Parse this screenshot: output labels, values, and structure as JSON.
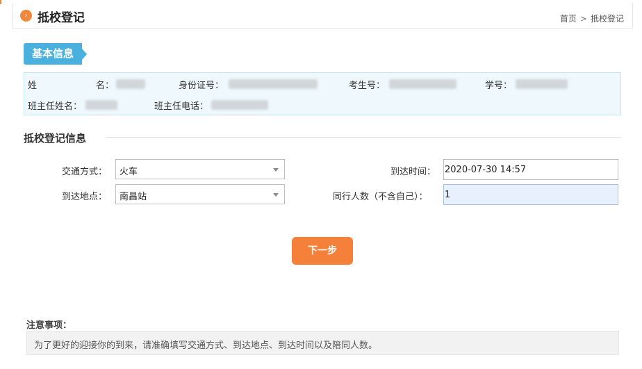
{
  "header": {
    "title": "抵校登记",
    "icon": "chevron-right-circle-icon",
    "breadcrumb": {
      "home": "首页",
      "separator": ">",
      "current": "抵校登记"
    }
  },
  "basic_info": {
    "tag": "基本信息",
    "name_label_1": "姓",
    "name_label_2": "名：",
    "id_label": "身份证号：",
    "exam_no_label": "考生号：",
    "student_no_label": "学号：",
    "teacher_name_label": "班主任姓名：",
    "teacher_phone_label": "班主任电话："
  },
  "registration": {
    "section_title": "抵校登记信息",
    "transport": {
      "label": "交通方式：",
      "value": "火车"
    },
    "arrival_time": {
      "label": "到达时间：",
      "value": "2020-07-30 14:57"
    },
    "arrival_place": {
      "label": "到达地点：",
      "value": "南昌站"
    },
    "companions": {
      "label": "同行人数（不含自己）：",
      "value": "1"
    },
    "next_button": "下一步"
  },
  "notice": {
    "title": "注意事项：",
    "text": "为了更好的迎接你的到来，请准确填写交通方式、到达地点、到达时间以及陪同人数。"
  },
  "colors": {
    "accent": "#f5803a",
    "tag": "#4ab1df",
    "info_background": "#eef8fd"
  }
}
